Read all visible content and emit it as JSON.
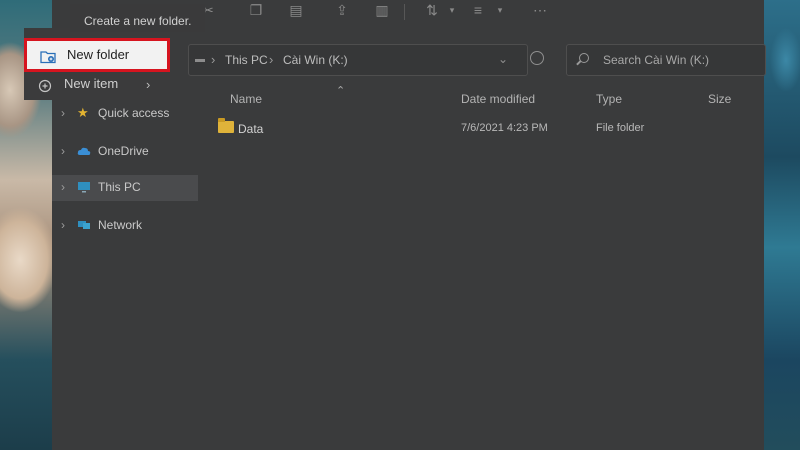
{
  "tooltip": {
    "text": "Create a new folder."
  },
  "new_menu": {
    "items": [
      {
        "label": "New folder",
        "icon": "new-folder-icon"
      },
      {
        "label": "New item",
        "icon": "new-item-icon",
        "has_submenu": true
      }
    ]
  },
  "address_bar": {
    "breadcrumbs": [
      "This PC",
      "Cài Win (K:)"
    ]
  },
  "search": {
    "placeholder": "Search Cài Win (K:)"
  },
  "navigation": {
    "items": [
      {
        "label": "Quick access",
        "icon": "star-icon",
        "selected": false
      },
      {
        "label": "OneDrive",
        "icon": "cloud-icon",
        "selected": false
      },
      {
        "label": "This PC",
        "icon": "monitor-icon",
        "selected": true
      },
      {
        "label": "Network",
        "icon": "network-icon",
        "selected": false
      }
    ]
  },
  "file_list": {
    "columns": [
      "Name",
      "Date modified",
      "Type",
      "Size"
    ],
    "rows": [
      {
        "name": "Data",
        "date_modified": "7/6/2021 4:23 PM",
        "type": "File folder",
        "size": ""
      }
    ]
  },
  "colors": {
    "highlight_border": "#d6141f",
    "folder": "#dfb33a",
    "window_bg": "#3a3b3c"
  }
}
